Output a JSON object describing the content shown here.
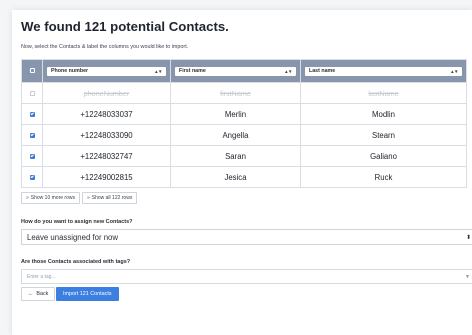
{
  "title": "We found 121 potential Contacts.",
  "subtitle": "Now, select the Contacts & label the columns you would like to import.",
  "columns": [
    {
      "label": "Phone number"
    },
    {
      "label": "First name"
    },
    {
      "label": "Last name"
    }
  ],
  "header_row": [
    "phoneNumber",
    "firstName",
    "lastName"
  ],
  "rows": [
    {
      "checked": true,
      "cells": [
        "+12248033037",
        "Merlin",
        "Modlin"
      ]
    },
    {
      "checked": true,
      "cells": [
        "+12248033090",
        "Angella",
        "Stearn"
      ]
    },
    {
      "checked": true,
      "cells": [
        "+12248032747",
        "Saran",
        "Galiano"
      ]
    },
    {
      "checked": true,
      "cells": [
        "+12249002815",
        "Jesica",
        "Ruck"
      ]
    }
  ],
  "row_buttons": {
    "show_more": "Show 10 more rows",
    "show_all": "Show all 122 rows"
  },
  "assign": {
    "label": "How do you want to assign new Contacts?",
    "value": "Leave unassigned for now"
  },
  "tags": {
    "label": "Are those Contacts associated with tags?",
    "placeholder": "Enter a tag..."
  },
  "buttons": {
    "back": "Back",
    "import": "Import 121 Contacts"
  },
  "colors": {
    "header_bg": "#8796ad",
    "accent": "#3b7fe0",
    "checkbox": "#3a7bd5"
  }
}
